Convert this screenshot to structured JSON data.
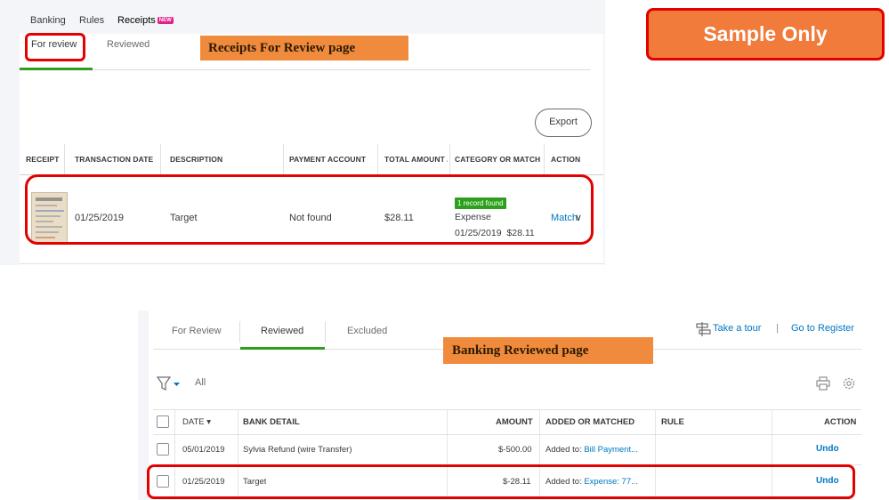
{
  "top_nav": {
    "banking": "Banking",
    "rules": "Rules",
    "receipts": "Receipts",
    "new_badge": "NEW"
  },
  "receipts_tabs": {
    "for_review": "For review",
    "reviewed": "Reviewed"
  },
  "callouts": {
    "receipts": "Receipts For Review page",
    "banking": "Banking Reviewed page"
  },
  "sample_badge": "Sample Only",
  "export_label": "Export",
  "receipts_table": {
    "headers": [
      "RECEIPT",
      "TRANSACTION DATE",
      "DESCRIPTION",
      "PAYMENT ACCOUNT",
      "TOTAL AMOUNT / TAX",
      "CATEGORY OR MATCH",
      "ACTION"
    ],
    "row": {
      "date": "01/25/2019",
      "description": "Target",
      "payment_account": "Not found",
      "total": "$28.11",
      "match_badge": "1 record found",
      "match_type": "Expense",
      "match_detail": "01/25/2019  $28.11",
      "action": "Match",
      "action_chevron": "∨"
    }
  },
  "banking_tabs": {
    "for_review": "For Review",
    "reviewed": "Reviewed",
    "excluded": "Excluded"
  },
  "banking_links": {
    "take_tour": "Take a tour",
    "separator": "|",
    "go_register": "Go to Register"
  },
  "filter": {
    "all": "All"
  },
  "banking_table": {
    "headers": {
      "date": "DATE ▾",
      "bank_detail": "BANK DETAIL",
      "amount": "AMOUNT",
      "added_or_matched": "ADDED OR MATCHED",
      "rule": "RULE",
      "action": "ACTION"
    },
    "rows": [
      {
        "date": "05/01/2019",
        "bank_detail": "Sylvia Refund (wire Transfer)",
        "amount": "$-500.00",
        "added_prefix": "Added to:",
        "added_link": "Bill Payment...",
        "rule": "",
        "action": "Undo"
      },
      {
        "date": "01/25/2019",
        "bank_detail": "Target",
        "amount": "$-28.11",
        "added_prefix": "Added to:",
        "added_link": "Expense: 77...",
        "rule": "",
        "action": "Undo"
      }
    ]
  },
  "colors": {
    "accent_green": "#2ca01c",
    "link_blue": "#0077c5",
    "highlight_red": "#e30000",
    "callout_orange": "#f08a3c"
  }
}
